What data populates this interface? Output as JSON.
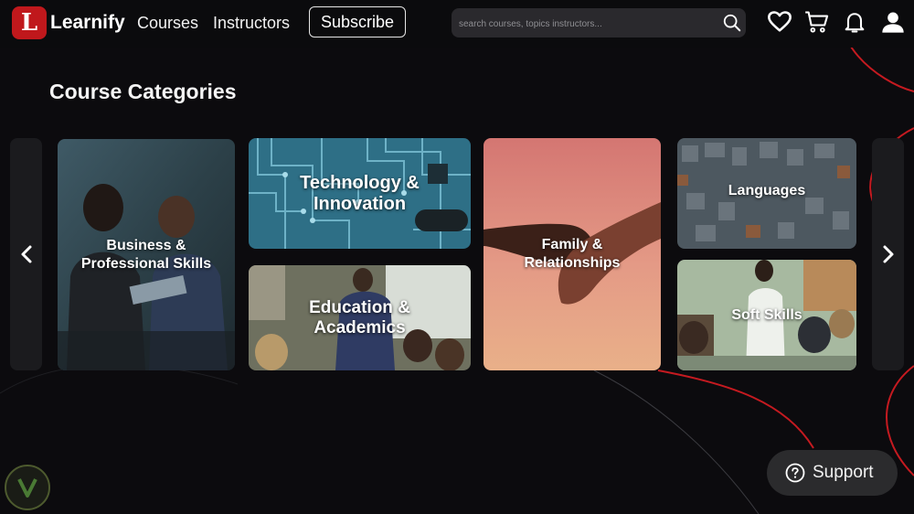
{
  "header": {
    "logo_letter": "L",
    "brand": "Learnify",
    "nav": [
      "Courses",
      "Instructors"
    ],
    "subscribe_label": "Subscribe",
    "search_placeholder": "search courses, topics instructors...",
    "icons": [
      "heart-icon",
      "cart-icon",
      "bell-icon",
      "user-icon"
    ]
  },
  "main": {
    "title": "Course Categories",
    "categories": [
      {
        "label": "Business & Professional Skills"
      },
      {
        "label": "Technology & Innovation"
      },
      {
        "label": "Education & Academics"
      },
      {
        "label": "Family & Relationships"
      },
      {
        "label": "Languages"
      },
      {
        "label": "Soft Skills"
      }
    ],
    "prev_icon": "chevron-left-icon",
    "next_icon": "chevron-right-icon"
  },
  "support": {
    "label": "Support",
    "icon": "help-circle-icon"
  },
  "colors": {
    "brand": "#c0181c",
    "background": "#0c0b0e",
    "accent_lines": "#d81e24"
  }
}
